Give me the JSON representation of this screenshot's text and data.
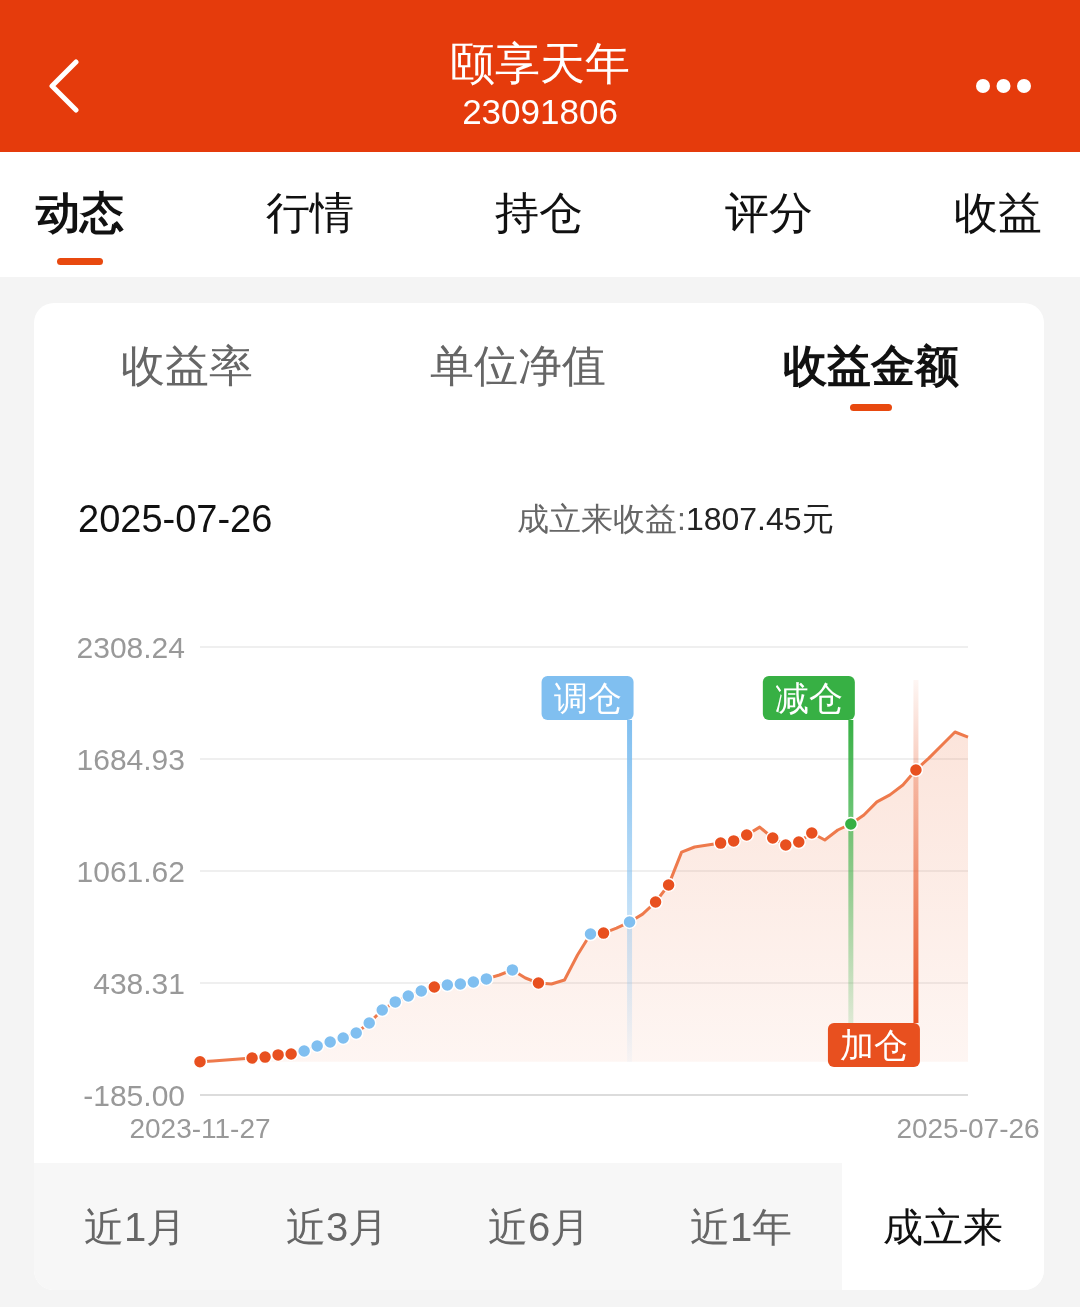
{
  "header": {
    "title": "颐享天年",
    "subtitle": "23091806"
  },
  "tabs": [
    {
      "label": "动态",
      "selected": true
    },
    {
      "label": "行情",
      "selected": false
    },
    {
      "label": "持仓",
      "selected": false
    },
    {
      "label": "评分",
      "selected": false
    },
    {
      "label": "收益",
      "selected": false
    }
  ],
  "card": {
    "tabs": [
      {
        "label": "收益率",
        "selected": false
      },
      {
        "label": "单位净值",
        "selected": false
      },
      {
        "label": "收益金额",
        "selected": true
      }
    ],
    "date": "2025-07-26",
    "income_label": "成立来收益:",
    "income_value": "1807.45元",
    "chart_data": {
      "type": "area",
      "grid": true,
      "ylim": [
        -185,
        2308.24
      ],
      "yticks": [
        2308.24,
        1684.93,
        1061.62,
        438.31,
        {
          "value": -185,
          "label": "-185.00"
        }
      ],
      "categories": [
        "2023-11-27",
        null,
        null,
        null,
        null,
        null,
        null,
        null,
        null,
        null,
        null,
        null,
        null,
        null,
        null,
        null,
        null,
        null,
        null,
        null,
        null,
        null,
        null,
        null,
        null,
        null,
        null,
        null,
        null,
        null,
        null,
        null,
        null,
        null,
        null,
        null,
        null,
        null,
        null,
        null,
        null,
        null,
        null,
        null,
        null,
        null,
        null,
        null,
        null,
        null,
        null,
        null,
        null,
        null,
        null,
        null,
        null,
        null,
        null,
        "2025-07-26"
      ],
      "series": [
        {
          "color": "#ee7a4c",
          "values": [
            0,
            4,
            10,
            15,
            21,
            26,
            38,
            43,
            60,
            88,
            110,
            132,
            160,
            216,
            288,
            333,
            366,
            394,
            416,
            427,
            433,
            444,
            461,
            483,
            511,
            466,
            438,
            433,
            455,
            594,
            711,
            716,
            744,
            778,
            822,
            889,
            984,
            1167,
            1195,
            1206,
            1217,
            1229,
            1262,
            1306,
            1245,
            1206,
            1223,
            1273,
            1234,
            1290,
            1323,
            1373,
            1446,
            1485,
            1540,
            1624,
            1690,
            1763,
            1835,
            1807
          ]
        },
        {
          "type": "scatter",
          "name": "调仓",
          "color": "#80bff0",
          "values": [
            null,
            null,
            null,
            null,
            null,
            null,
            null,
            null,
            60,
            88,
            110,
            132,
            160,
            216,
            288,
            333,
            366,
            394,
            null,
            427,
            433,
            444,
            461,
            null,
            511,
            null,
            null,
            null,
            null,
            null,
            711,
            null,
            null,
            778,
            null,
            null,
            null,
            null,
            null,
            null,
            null,
            null,
            null,
            null,
            null,
            null,
            null,
            null,
            null,
            null,
            null,
            null,
            null,
            null,
            null,
            null,
            null,
            null,
            null,
            null
          ]
        },
        {
          "type": "scatter",
          "name": "减仓",
          "color": "#37b044",
          "values": [
            null,
            null,
            null,
            null,
            null,
            null,
            null,
            null,
            null,
            null,
            null,
            null,
            null,
            null,
            null,
            null,
            null,
            null,
            null,
            null,
            null,
            null,
            null,
            null,
            null,
            null,
            null,
            null,
            null,
            null,
            null,
            null,
            null,
            null,
            null,
            null,
            null,
            null,
            null,
            null,
            null,
            null,
            null,
            null,
            null,
            null,
            null,
            null,
            null,
            null,
            1323,
            null,
            null,
            null,
            null,
            null,
            null,
            null,
            null,
            null
          ]
        },
        {
          "type": "scatter",
          "name": "加仓",
          "color": "#e8501f",
          "values": [
            0,
            null,
            null,
            null,
            21,
            26,
            38,
            43,
            null,
            null,
            null,
            null,
            null,
            null,
            null,
            null,
            null,
            null,
            416,
            null,
            null,
            null,
            null,
            null,
            null,
            null,
            438,
            null,
            null,
            null,
            null,
            716,
            null,
            null,
            null,
            889,
            984,
            null,
            null,
            null,
            1217,
            1229,
            1262,
            null,
            1245,
            1206,
            1223,
            1273,
            null,
            null,
            null,
            null,
            null,
            null,
            null,
            1624,
            null,
            null,
            null,
            null
          ]
        }
      ]
    },
    "periods": [
      {
        "label": "近1月",
        "selected": false
      },
      {
        "label": "近3月",
        "selected": false
      },
      {
        "label": "近6月",
        "selected": false
      },
      {
        "label": "近1年",
        "selected": false
      },
      {
        "label": "成立来",
        "selected": true
      }
    ]
  }
}
